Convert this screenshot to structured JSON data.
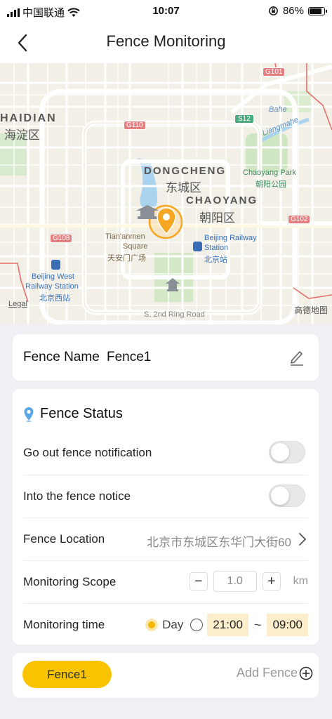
{
  "status_bar": {
    "carrier": "中国联通",
    "time": "10:07",
    "battery": "86%"
  },
  "header": {
    "title": "Fence Monitoring"
  },
  "map": {
    "labels": {
      "haidian_en": "HAIDIAN",
      "haidian_cn": "海淀区",
      "dongcheng_en": "DONGCHENG",
      "dongcheng_cn": "东城区",
      "chaoyang_en": "CHAOYANG",
      "chaoyang_cn": "朝阳区",
      "chaoyang_park_en": "Chaoyang Park",
      "chaoyang_park_cn": "朝阳公园",
      "tiananmen_en1": "Tian'anmen",
      "tiananmen_en2": "Square",
      "tiananmen_cn": "天安门广场",
      "bj_station_en1": "Beijing Railway",
      "bj_station_en2": "Station",
      "bj_station_cn": "北京站",
      "bj_west_en1": "Beijing West",
      "bj_west_en2": "Railway Station",
      "bj_west_cn": "北京西站",
      "bahe": "Bahe",
      "liangmahe": "Liangmahe",
      "ring_road": "S. 2nd Ring Road",
      "legal": "Legal",
      "provider": "高德地图"
    },
    "shields": {
      "g101": "G101",
      "g110": "G110",
      "s12": "S12",
      "g108": "G108",
      "g102": "G102"
    }
  },
  "fence_name": {
    "label": "Fence Name",
    "value": "Fence1"
  },
  "fence_status": {
    "title": "Fence Status",
    "go_out_label": "Go out fence notification",
    "go_out_on": false,
    "into_label": "Into the fence notice",
    "into_on": false,
    "location_label": "Fence Location",
    "location_value": "北京市东城区东华门大街60",
    "scope_label": "Monitoring Scope",
    "scope_value": "1.0",
    "scope_unit": "km",
    "minus": "−",
    "plus": "+",
    "time_label": "Monitoring time",
    "day_label": "Day",
    "time_start": "21:00",
    "tilde": "~",
    "time_end": "09:00"
  },
  "fence_list": {
    "active_fence": "Fence1",
    "add_label": "Add Fence"
  }
}
